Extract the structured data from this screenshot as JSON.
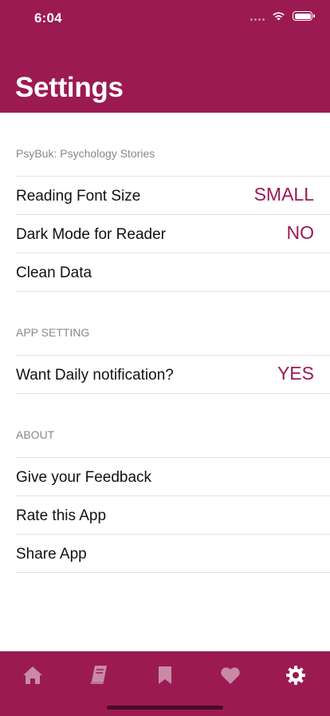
{
  "status_bar": {
    "time": "6:04"
  },
  "header": {
    "title": "Settings"
  },
  "sections": [
    {
      "header": "PsyBuk: Psychology Stories",
      "rows": [
        {
          "label": "Reading Font Size",
          "value": "SMALL"
        },
        {
          "label": "Dark Mode for Reader",
          "value": "NO"
        },
        {
          "label": "Clean Data",
          "value": ""
        }
      ]
    },
    {
      "header": "APP SETTING",
      "rows": [
        {
          "label": "Want Daily notification?",
          "value": "YES"
        }
      ]
    },
    {
      "header": "ABOUT",
      "rows": [
        {
          "label": "Give your Feedback",
          "value": ""
        },
        {
          "label": "Rate this App",
          "value": ""
        },
        {
          "label": "Share App",
          "value": ""
        }
      ]
    }
  ],
  "tab_bar": {
    "items": [
      {
        "icon": "home-icon",
        "active": false
      },
      {
        "icon": "book-icon",
        "active": false
      },
      {
        "icon": "bookmark-icon",
        "active": false
      },
      {
        "icon": "heart-icon",
        "active": false
      },
      {
        "icon": "gear-icon",
        "active": true
      }
    ]
  },
  "colors": {
    "accent": "#9b1a52",
    "tab_inactive": "#c98aa5",
    "tab_active": "#ffffff",
    "section_header": "#888888"
  }
}
